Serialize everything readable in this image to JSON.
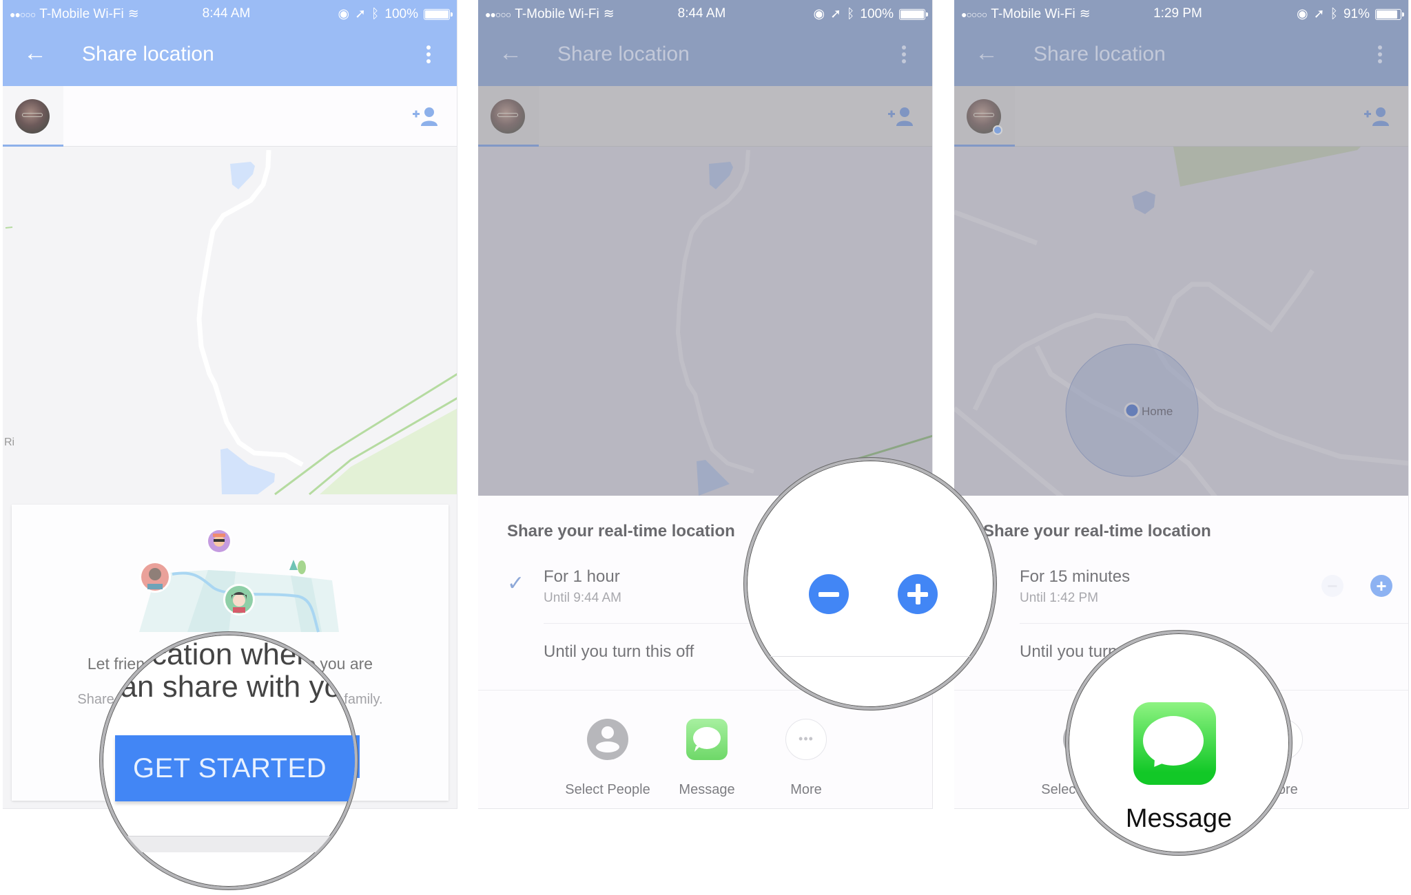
{
  "colors": {
    "accent_blue": "#4286f5",
    "appbar_blue": "#9bbcf5",
    "message_green": "#12c827"
  },
  "panels": [
    {
      "status": {
        "signal": "●●○○○",
        "carrier": "T-Mobile Wi-Fi",
        "time": "8:44 AM",
        "battery": "100%",
        "battery_level": 1.0
      },
      "appbar": {
        "back_icon": "arrow-left-icon",
        "title": "Share location",
        "menu_icon": "more-vert-icon"
      },
      "tabs": {
        "add_person_icon": "person-add-icon"
      },
      "map": {
        "label_fragment": "Ri"
      },
      "intro_card": {
        "headline": "Let friends and family see where you are",
        "subline": "Share your real-time location with friends & family.",
        "button": "GET STARTED"
      },
      "magnifier": {
        "line1": "e location where you are",
        "line2": "can share with you",
        "button": "GET STARTED"
      }
    },
    {
      "status": {
        "signal": "●●○○○",
        "carrier": "T-Mobile Wi-Fi",
        "time": "8:44 AM",
        "battery": "100%",
        "battery_level": 1.0
      },
      "appbar": {
        "back_icon": "arrow-left-icon",
        "title": "Share location",
        "menu_icon": "more-vert-icon"
      },
      "sheet": {
        "heading": "Share your real-time location",
        "option1": {
          "label": "For 1 hour",
          "sublabel": "Until 9:44 AM",
          "selected": true
        },
        "option2": {
          "label": "Until you turn this off",
          "selected": false
        },
        "share_targets": [
          {
            "label": "Select People",
            "icon": "person-icon"
          },
          {
            "label": "Message",
            "icon": "messages-app-icon"
          },
          {
            "label": "More",
            "icon": "more-horiz-icon"
          }
        ]
      },
      "magnifier": {
        "minus_icon": "minus-circle-icon",
        "plus_icon": "plus-circle-icon"
      }
    },
    {
      "status": {
        "signal": "●○○○○",
        "carrier": "T-Mobile Wi-Fi",
        "time": "1:29 PM",
        "battery": "91%",
        "battery_level": 0.91
      },
      "appbar": {
        "back_icon": "arrow-left-icon",
        "title": "Share location",
        "menu_icon": "more-vert-icon"
      },
      "map": {
        "place_label": "Home"
      },
      "sheet": {
        "heading": "Share your real-time location",
        "option1": {
          "label": "For 15 minutes",
          "sublabel": "Until 1:42 PM",
          "selected": true
        },
        "option2": {
          "label": "Until you turn this off",
          "selected": false
        },
        "share_targets": [
          {
            "label": "Select People",
            "icon": "person-icon"
          },
          {
            "label": "Message",
            "icon": "messages-app-icon"
          },
          {
            "label": "More",
            "icon": "more-horiz-icon"
          }
        ]
      },
      "magnifier": {
        "label": "Message"
      }
    }
  ]
}
